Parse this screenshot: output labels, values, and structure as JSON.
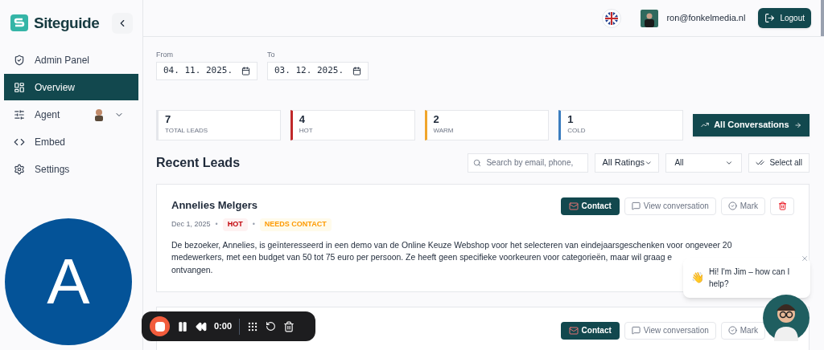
{
  "brand": {
    "name": "Siteguide"
  },
  "sidebar": {
    "items": [
      {
        "label": "Admin Panel",
        "kind": "admin",
        "selected": false
      },
      {
        "label": "Overview",
        "kind": "overview",
        "selected": true
      },
      {
        "label": "Agent",
        "kind": "agent",
        "selected": false
      },
      {
        "label": "Embed",
        "kind": "embed",
        "selected": false
      },
      {
        "label": "Settings",
        "kind": "settings",
        "selected": false
      }
    ]
  },
  "header": {
    "user_email": "ron@fonkelmedia.nl",
    "logout": "Logout"
  },
  "filters": {
    "from": {
      "label": "From",
      "value": "04. 11. 2025."
    },
    "to": {
      "label": "To",
      "value": "03. 12. 2025."
    }
  },
  "stats": [
    {
      "value": "7",
      "label": "TOTAL LEADS",
      "color": "#ffffff"
    },
    {
      "value": "4",
      "label": "HOT",
      "color": "#c0292b"
    },
    {
      "value": "2",
      "label": "WARM",
      "color": "#f0a52c"
    },
    {
      "value": "1",
      "label": "COLD",
      "color": "#3b7dbf"
    }
  ],
  "all_conversations": "All Conversations",
  "recent_leads": {
    "title": "Recent Leads",
    "search_placeholder": "Search by email, phone,",
    "rating_filter": "All Ratings",
    "status_filter": "All",
    "select_all": "Select all"
  },
  "leads": [
    {
      "name": "Annelies Melgers",
      "date": "Dec 1, 2025",
      "rating": "HOT",
      "status": "NEEDS CONTACT",
      "summary_lines": [
        "De bezoeker, Annelies, is geïnteresseerd in een demo van de Online Keuze Webshop voor het selecteren van eindejaarsgeschenken voor ongeveer 20",
        "medewerkers, met een budget van 50 tot 75 euro per persoon. Ze heeft geen specifieke voorkeuren voor categorieën, maar wil graag e",
        "ontvangen."
      ],
      "separators": [
        "•",
        "•"
      ],
      "actions": {
        "contact": "Contact",
        "view": "View conversation",
        "mark": "Mark",
        "delete_shown": true
      }
    },
    {
      "actions": {
        "contact": "Contact",
        "view": "View conversation",
        "mark": "Mark",
        "delete_shown": false
      }
    }
  ],
  "avatar_overlay": {
    "letter": "A"
  },
  "recorder": {
    "time": "0:00"
  },
  "chat": {
    "emoji": "👋",
    "message": "Hi! I'm Jim – how can I help?"
  }
}
